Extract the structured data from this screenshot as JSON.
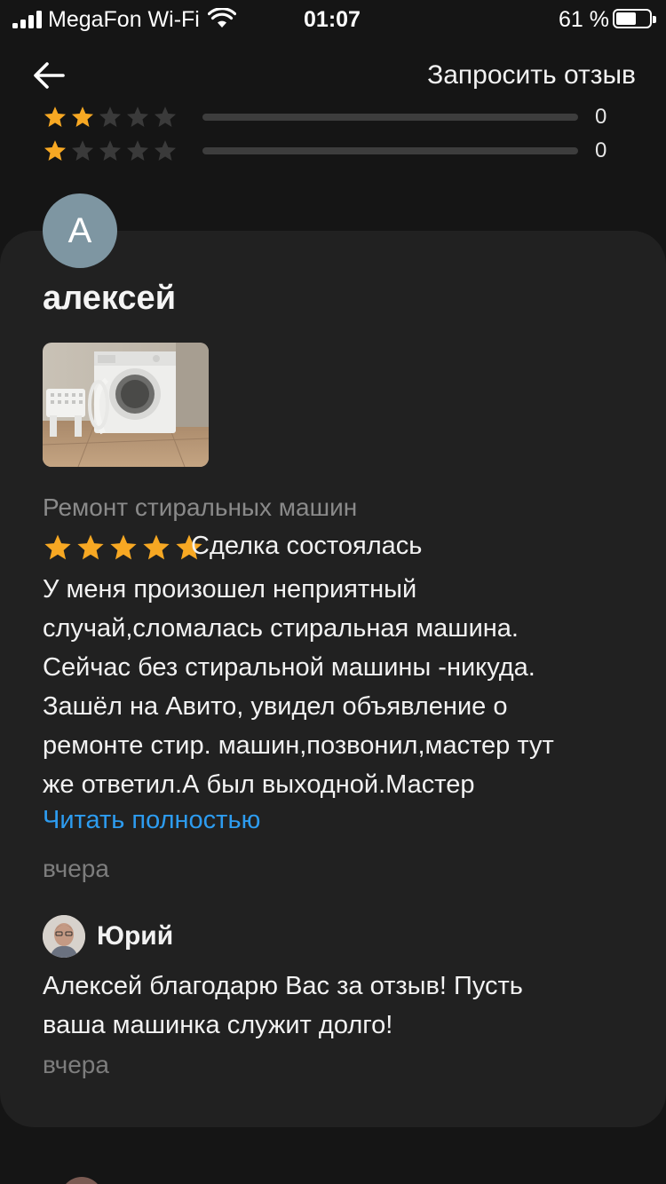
{
  "status_bar": {
    "carrier": "MegaFon Wi-Fi",
    "time": "01:07",
    "battery_percent": "61 %",
    "battery_level": 0.61
  },
  "nav": {
    "back_icon": "arrow-left-icon",
    "request_review": "Запросить отзыв"
  },
  "rating_breakdown": [
    {
      "stars": 2,
      "count": "0",
      "fraction": 0
    },
    {
      "stars": 1,
      "count": "0",
      "fraction": 0
    }
  ],
  "review": {
    "avatar_letter": "А",
    "author": "алексей",
    "service": "Ремонт стиральных машин",
    "rating": 5,
    "deal_status": "Сделка состоялась",
    "text_lines": [
      "У меня произошел неприятный",
      "случай,сломалась стиральная машина.",
      "Сейчас без стиральной машины -никуда.",
      "Зашёл на Авито, увидел объявление о",
      "ремонте стир. машин,позвонил,мастер тут",
      "же ответил.А был выходной.Мастер"
    ],
    "read_more": "Читать полностью",
    "date": "вчера"
  },
  "reply": {
    "author": "Юрий",
    "text_lines": [
      "Алексей благодарю Вас за отзыв! Пусть",
      "ваша машинка служит долго!"
    ],
    "date": "вчера"
  },
  "colors": {
    "background": "#151515",
    "card": "#212121",
    "star_active": "#f7a823",
    "star_inactive": "#3a3a3a",
    "link": "#2d9cf0",
    "muted": "#7d7d7d",
    "avatar_bg": "#7e96a2"
  }
}
